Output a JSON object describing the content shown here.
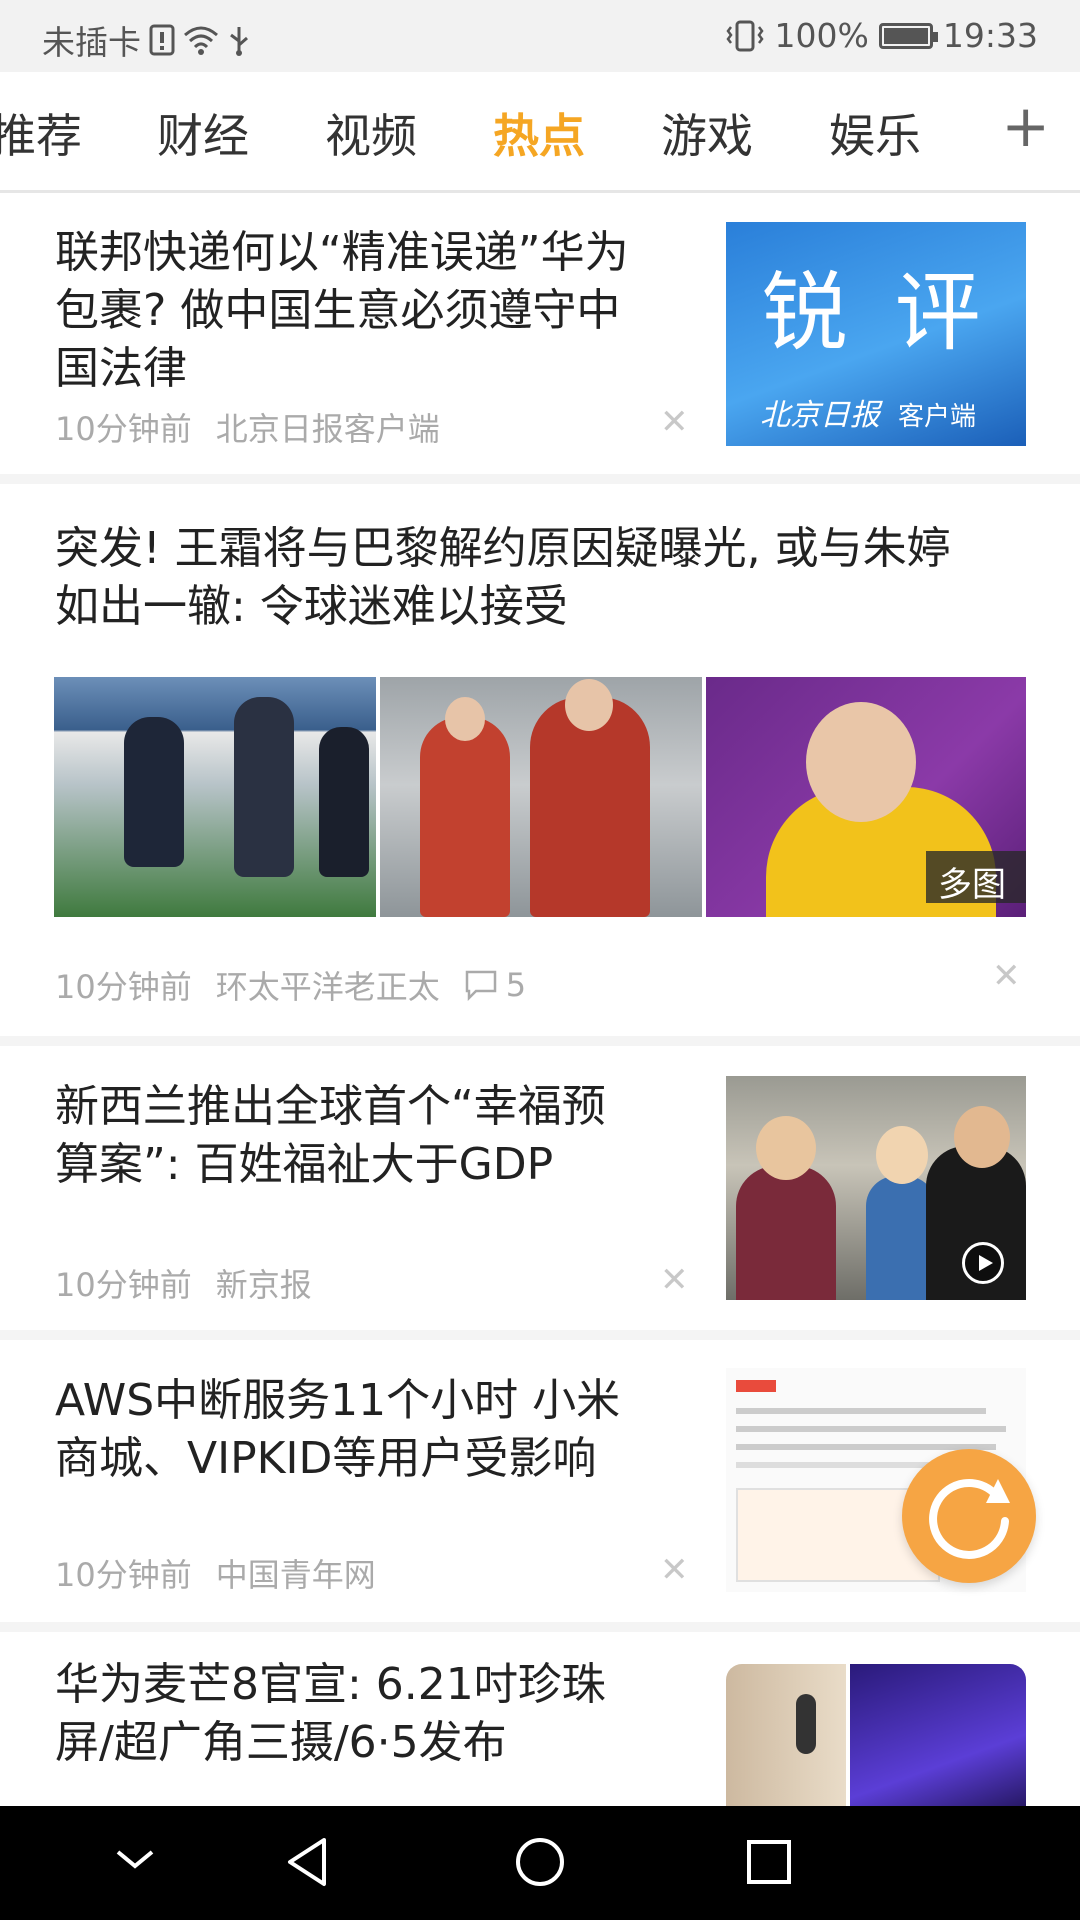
{
  "status_bar": {
    "carrier": "未插卡",
    "battery": "100%",
    "time": "19:33",
    "battery_level": 1.0
  },
  "tabs": [
    "推荐",
    "财经",
    "视频",
    "热点",
    "游戏",
    "娱乐"
  ],
  "active_tab_index": 3,
  "add_label": "+",
  "articles": [
    {
      "title_lines": [
        "联邦快递何以“精准误递”华为",
        "包裹? 做中国生意必须遵守中",
        "国法律"
      ],
      "time": "10分钟前",
      "source": "北京日报客户端",
      "thumb_text": "锐 评",
      "thumb_sub_brand": "北京日报",
      "thumb_sub": "客户端"
    },
    {
      "title_lines": [
        "突发! 王霜将与巴黎解约原因疑曝光, 或与朱婷",
        "如出一辙: 令球迷难以接受"
      ],
      "time": "10分钟前",
      "source": "环太平洋老正太",
      "comments": "5",
      "multi_label": "多图"
    },
    {
      "title_lines": [
        "新西兰推出全球首个“幸福预",
        "算案”: 百姓福祉大于GDP"
      ],
      "time": "10分钟前",
      "source": "新京报"
    },
    {
      "title_lines": [
        "AWS中断服务11个小时 小米",
        "商城、VIPKID等用户受影响"
      ],
      "time": "10分钟前",
      "source": "中国青年网"
    },
    {
      "title_lines": [
        "华为麦芒8官宣: 6.21吋珍珠",
        "屏/超广角三摄/6·5发布"
      ]
    }
  ],
  "colors": {
    "accent": "#f5a623",
    "refresh": "#f6a544"
  }
}
